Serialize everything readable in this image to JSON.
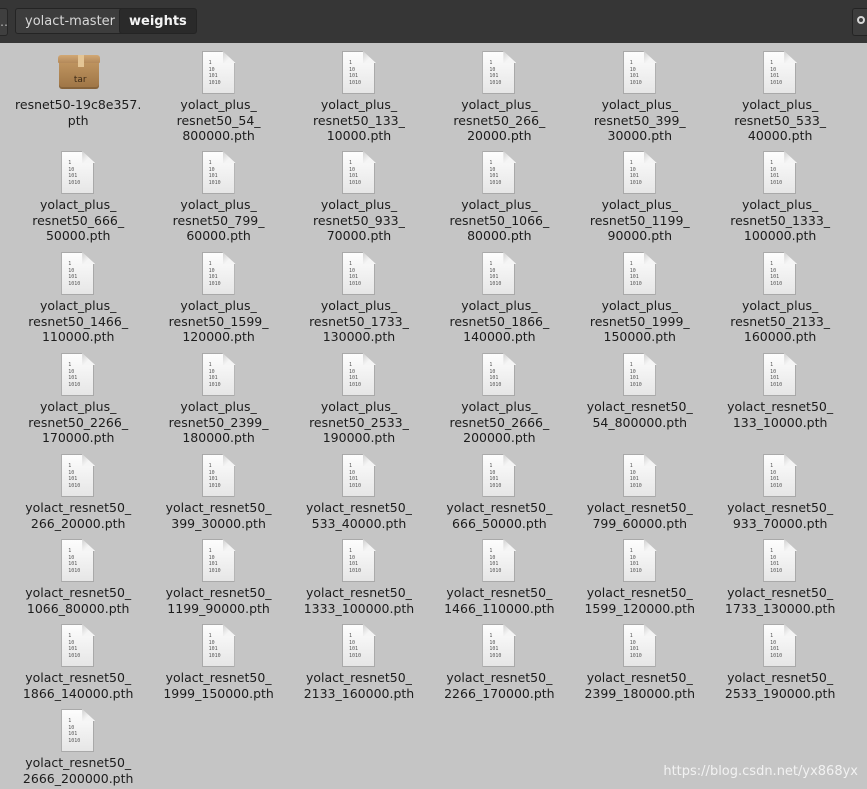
{
  "pathbar": {
    "prev_label": "…",
    "segments": [
      {
        "label": "yolact-master",
        "active": false
      },
      {
        "label": "weights",
        "active": true
      }
    ]
  },
  "icons": {
    "archive": "archive-icon",
    "binary": "binary-file-icon",
    "binary_glyph": "1\n10\n101\n1010",
    "archive_badge": "tar"
  },
  "files": [
    {
      "type": "archive",
      "lines": [
        "resnet50-19c8e357.",
        "pth"
      ]
    },
    {
      "type": "binary",
      "lines": [
        "yolact_plus_",
        "resnet50_54_",
        "800000.pth"
      ]
    },
    {
      "type": "binary",
      "lines": [
        "yolact_plus_",
        "resnet50_133_",
        "10000.pth"
      ]
    },
    {
      "type": "binary",
      "lines": [
        "yolact_plus_",
        "resnet50_266_",
        "20000.pth"
      ]
    },
    {
      "type": "binary",
      "lines": [
        "yolact_plus_",
        "resnet50_399_",
        "30000.pth"
      ]
    },
    {
      "type": "binary",
      "lines": [
        "yolact_plus_",
        "resnet50_533_",
        "40000.pth"
      ]
    },
    {
      "type": "binary",
      "lines": [
        "yolact_plus_",
        "resnet50_666_",
        "50000.pth"
      ]
    },
    {
      "type": "binary",
      "lines": [
        "yolact_plus_",
        "resnet50_799_",
        "60000.pth"
      ]
    },
    {
      "type": "binary",
      "lines": [
        "yolact_plus_",
        "resnet50_933_",
        "70000.pth"
      ]
    },
    {
      "type": "binary",
      "lines": [
        "yolact_plus_",
        "resnet50_1066_",
        "80000.pth"
      ]
    },
    {
      "type": "binary",
      "lines": [
        "yolact_plus_",
        "resnet50_1199_",
        "90000.pth"
      ]
    },
    {
      "type": "binary",
      "lines": [
        "yolact_plus_",
        "resnet50_1333_",
        "100000.pth"
      ]
    },
    {
      "type": "binary",
      "lines": [
        "yolact_plus_",
        "resnet50_1466_",
        "110000.pth"
      ]
    },
    {
      "type": "binary",
      "lines": [
        "yolact_plus_",
        "resnet50_1599_",
        "120000.pth"
      ]
    },
    {
      "type": "binary",
      "lines": [
        "yolact_plus_",
        "resnet50_1733_",
        "130000.pth"
      ]
    },
    {
      "type": "binary",
      "lines": [
        "yolact_plus_",
        "resnet50_1866_",
        "140000.pth"
      ]
    },
    {
      "type": "binary",
      "lines": [
        "yolact_plus_",
        "resnet50_1999_",
        "150000.pth"
      ]
    },
    {
      "type": "binary",
      "lines": [
        "yolact_plus_",
        "resnet50_2133_",
        "160000.pth"
      ]
    },
    {
      "type": "binary",
      "lines": [
        "yolact_plus_",
        "resnet50_2266_",
        "170000.pth"
      ]
    },
    {
      "type": "binary",
      "lines": [
        "yolact_plus_",
        "resnet50_2399_",
        "180000.pth"
      ]
    },
    {
      "type": "binary",
      "lines": [
        "yolact_plus_",
        "resnet50_2533_",
        "190000.pth"
      ]
    },
    {
      "type": "binary",
      "lines": [
        "yolact_plus_",
        "resnet50_2666_",
        "200000.pth"
      ]
    },
    {
      "type": "binary",
      "lines": [
        "yolact_resnet50_",
        "54_800000.pth"
      ]
    },
    {
      "type": "binary",
      "lines": [
        "yolact_resnet50_",
        "133_10000.pth"
      ]
    },
    {
      "type": "binary",
      "lines": [
        "yolact_resnet50_",
        "266_20000.pth"
      ]
    },
    {
      "type": "binary",
      "lines": [
        "yolact_resnet50_",
        "399_30000.pth"
      ]
    },
    {
      "type": "binary",
      "lines": [
        "yolact_resnet50_",
        "533_40000.pth"
      ]
    },
    {
      "type": "binary",
      "lines": [
        "yolact_resnet50_",
        "666_50000.pth"
      ]
    },
    {
      "type": "binary",
      "lines": [
        "yolact_resnet50_",
        "799_60000.pth"
      ]
    },
    {
      "type": "binary",
      "lines": [
        "yolact_resnet50_",
        "933_70000.pth"
      ]
    },
    {
      "type": "binary",
      "lines": [
        "yolact_resnet50_",
        "1066_80000.pth"
      ]
    },
    {
      "type": "binary",
      "lines": [
        "yolact_resnet50_",
        "1199_90000.pth"
      ]
    },
    {
      "type": "binary",
      "lines": [
        "yolact_resnet50_",
        "1333_100000.pth"
      ]
    },
    {
      "type": "binary",
      "lines": [
        "yolact_resnet50_",
        "1466_110000.pth"
      ]
    },
    {
      "type": "binary",
      "lines": [
        "yolact_resnet50_",
        "1599_120000.pth"
      ]
    },
    {
      "type": "binary",
      "lines": [
        "yolact_resnet50_",
        "1733_130000.pth"
      ]
    },
    {
      "type": "binary",
      "lines": [
        "yolact_resnet50_",
        "1866_140000.pth"
      ]
    },
    {
      "type": "binary",
      "lines": [
        "yolact_resnet50_",
        "1999_150000.pth"
      ]
    },
    {
      "type": "binary",
      "lines": [
        "yolact_resnet50_",
        "2133_160000.pth"
      ]
    },
    {
      "type": "binary",
      "lines": [
        "yolact_resnet50_",
        "2266_170000.pth"
      ]
    },
    {
      "type": "binary",
      "lines": [
        "yolact_resnet50_",
        "2399_180000.pth"
      ]
    },
    {
      "type": "binary",
      "lines": [
        "yolact_resnet50_",
        "2533_190000.pth"
      ]
    },
    {
      "type": "binary",
      "lines": [
        "yolact_resnet50_",
        "2666_200000.pth"
      ]
    }
  ],
  "watermark": "https://blog.csdn.net/yx868yx",
  "colors": {
    "background": "#c5c5c5",
    "pathbar": "#363636",
    "text": "#1c1c1c"
  }
}
